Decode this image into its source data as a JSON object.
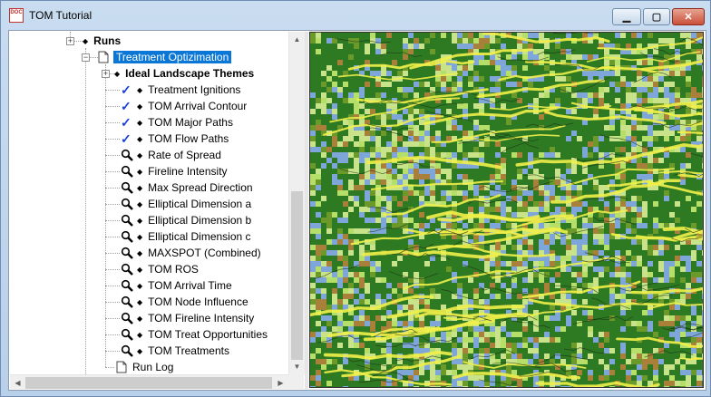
{
  "window": {
    "title": "TOM Tutorial",
    "app_icon_text": "DOC"
  },
  "controls": {
    "minimize": "▁",
    "maximize": "▢",
    "close": "✕"
  },
  "tree": {
    "runs_label": "Runs",
    "selected_item": "Treatment Optizimation",
    "group_label": "Ideal Landscape Themes",
    "items": [
      {
        "label": "Treatment Ignitions",
        "icon": "checkmark-icon"
      },
      {
        "label": "TOM Arrival Contour",
        "icon": "checkmark-icon"
      },
      {
        "label": "TOM Major Paths",
        "icon": "checkmark-icon"
      },
      {
        "label": "TOM Flow Paths",
        "icon": "checkmark-icon"
      },
      {
        "label": "Rate of Spread",
        "icon": "magnifier-icon"
      },
      {
        "label": "Fireline Intensity",
        "icon": "magnifier-icon"
      },
      {
        "label": "Max Spread Direction",
        "icon": "magnifier-icon"
      },
      {
        "label": "Elliptical Dimension a",
        "icon": "magnifier-icon"
      },
      {
        "label": "Elliptical Dimension b",
        "icon": "magnifier-icon"
      },
      {
        "label": "Elliptical Dimension c",
        "icon": "magnifier-icon"
      },
      {
        "label": "MAXSPOT (Combined)",
        "icon": "magnifier-icon"
      },
      {
        "label": "TOM ROS",
        "icon": "magnifier-icon"
      },
      {
        "label": "TOM Arrival Time",
        "icon": "magnifier-icon"
      },
      {
        "label": "TOM Node Influence",
        "icon": "magnifier-icon"
      },
      {
        "label": "TOM Fireline Intensity",
        "icon": "magnifier-icon"
      },
      {
        "label": "TOM Treat Opportunities",
        "icon": "magnifier-icon"
      },
      {
        "label": "TOM Treatments",
        "icon": "magnifier-icon"
      }
    ],
    "log_label": "Run Log"
  },
  "map_colors": {
    "dark_green": "#2e7a22",
    "light_green": "#c9e38a",
    "lime": "#b6df6a",
    "blue": "#7ea6d8",
    "brown": "#a9803a",
    "yellow": "#f1f04a",
    "olive": "#6c9a2a"
  }
}
